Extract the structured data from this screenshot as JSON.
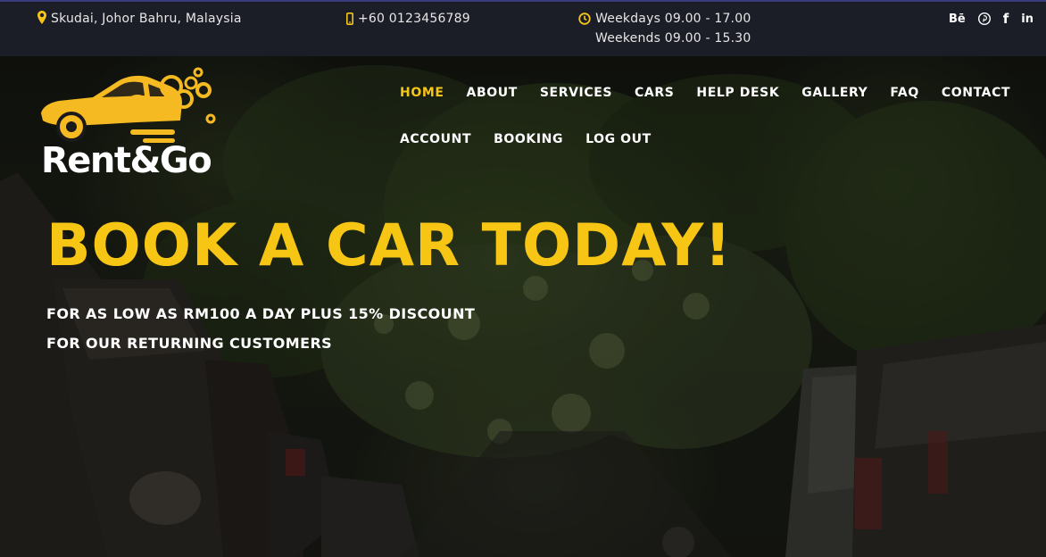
{
  "topbar": {
    "location": "Skudai, Johor Bahru, Malaysia",
    "phone": "+60 0123456789",
    "hours_weekdays": "Weekdays 09.00 - 17.00",
    "hours_weekends": "Weekends 09.00 - 15.30",
    "social": [
      {
        "icon": "behance-icon",
        "glyph": "Bē"
      },
      {
        "icon": "pinterest-icon",
        "glyph": "P"
      },
      {
        "icon": "facebook-icon",
        "glyph": "f"
      },
      {
        "icon": "linkedin-icon",
        "glyph": "in"
      }
    ]
  },
  "logo": {
    "text": "Rent&Go"
  },
  "nav": {
    "row1": [
      "HOME",
      "ABOUT",
      "SERVICES",
      "CARS",
      "HELP DESK",
      "GALLERY",
      "FAQ",
      "CONTACT"
    ],
    "row2": [
      "ACCOUNT",
      "BOOKING",
      "LOG OUT"
    ],
    "active": "HOME"
  },
  "hero": {
    "headline": "BOOK A CAR TODAY!",
    "sub_line1": "FOR AS LOW AS RM100 A DAY PLUS 15% DISCOUNT",
    "sub_line2": "FOR OUR RETURNING CUSTOMERS"
  },
  "colors": {
    "accent": "#f5c518",
    "topbar_bg": "#1c1e27",
    "text": "#ffffff"
  }
}
